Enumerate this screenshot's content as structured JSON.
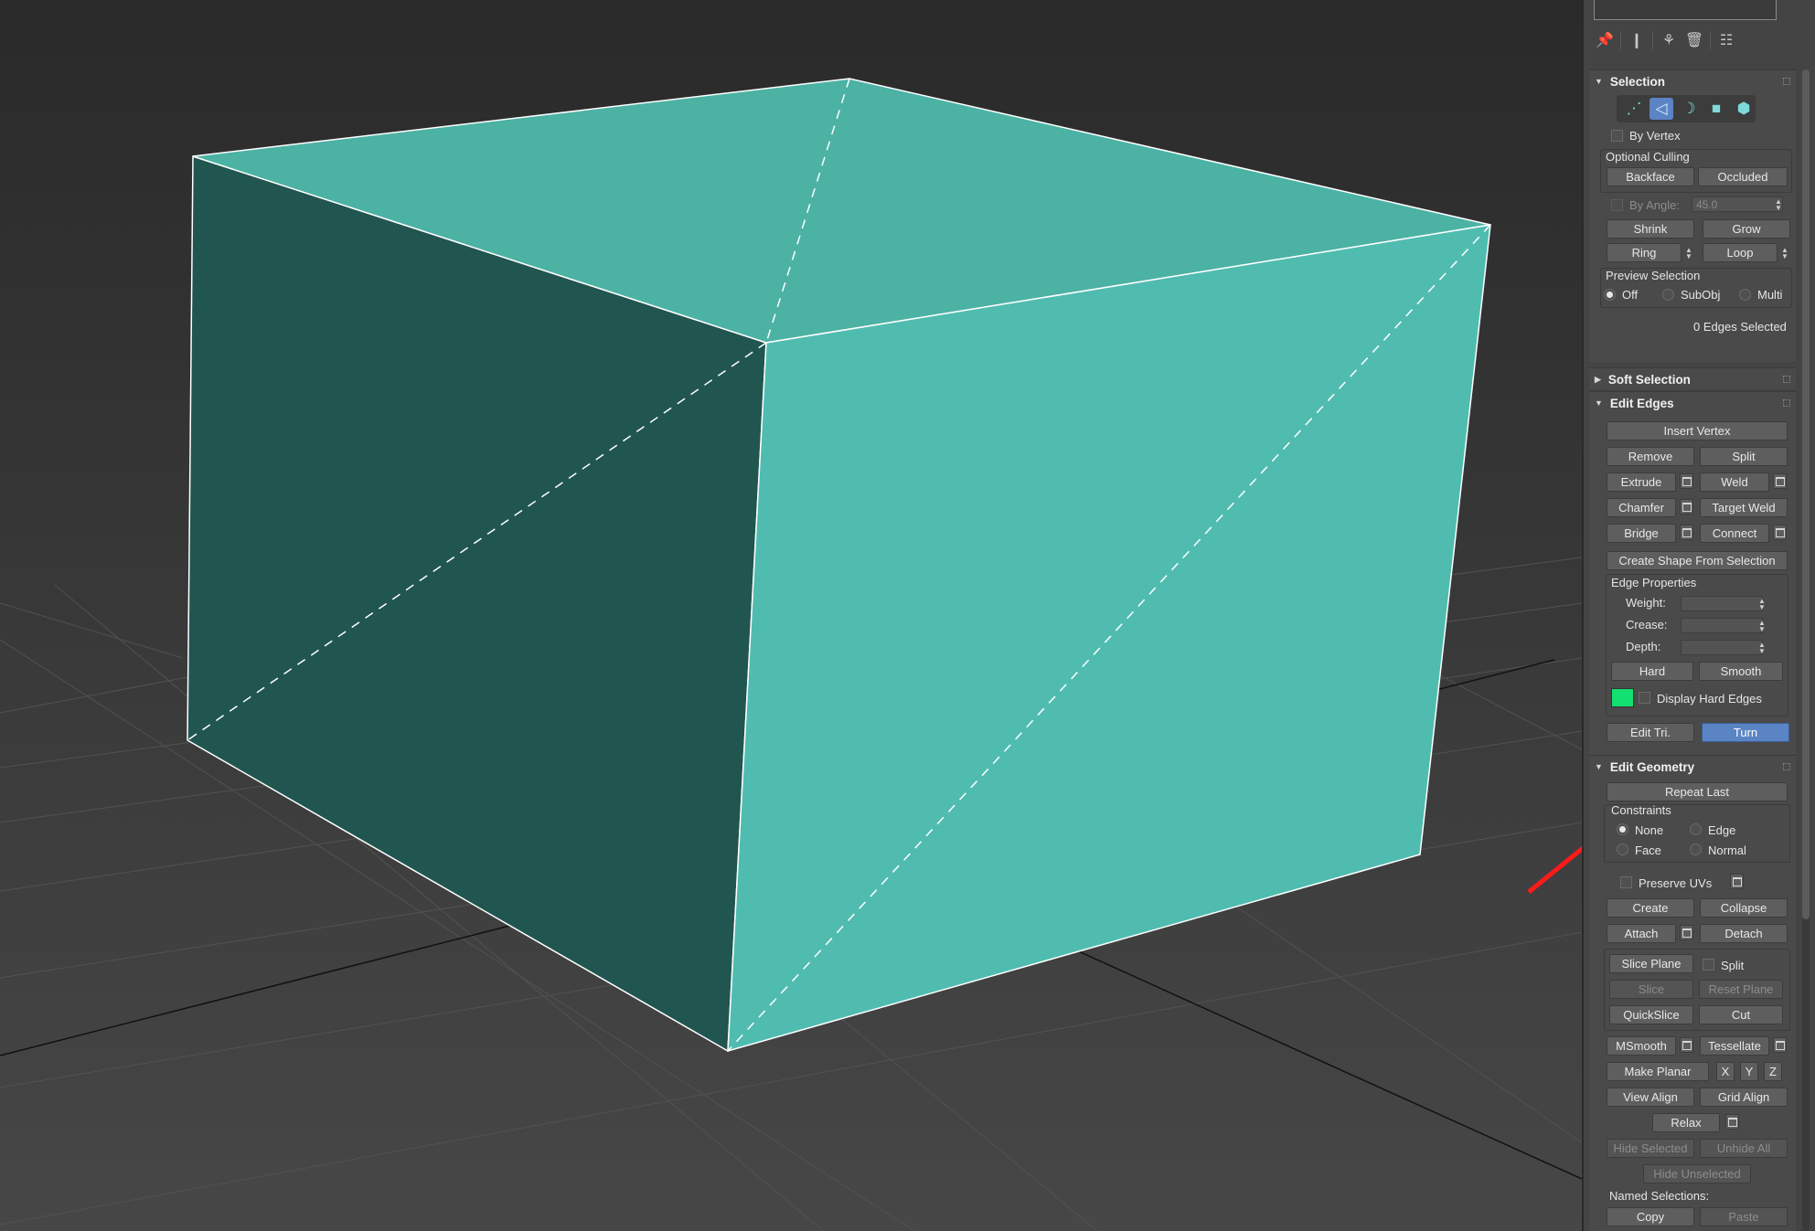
{
  "viewport": {
    "face_colors": {
      "top": "#4cb2a4",
      "front": "#50bcb0",
      "side": "#215550",
      "grid_line": "#4a4a4a",
      "axis": "#101010"
    },
    "edge_color": "#ffffff"
  },
  "panel": {
    "toolbar_icons": [
      "pin-icon",
      "modifier-stack-icon",
      "make-unique-icon",
      "delete-icon",
      "configure-icon"
    ],
    "selection": {
      "title": "Selection",
      "subobject_icons": [
        "vertex-icon",
        "edge-icon",
        "border-icon",
        "polygon-icon",
        "element-icon"
      ],
      "by_vertex": "By Vertex",
      "optional_culling": "Optional Culling",
      "backface": "Backface",
      "occluded": "Occluded",
      "by_angle": "By Angle:",
      "by_angle_value": "45.0",
      "shrink": "Shrink",
      "grow": "Grow",
      "ring": "Ring",
      "loop": "Loop",
      "preview_selection": "Preview Selection",
      "preview_off": "Off",
      "preview_subobj": "SubObj",
      "preview_multi": "Multi",
      "status": "0 Edges Selected"
    },
    "soft_selection": {
      "title": "Soft Selection"
    },
    "edit_edges": {
      "title": "Edit Edges",
      "insert_vertex": "Insert Vertex",
      "remove": "Remove",
      "split": "Split",
      "extrude": "Extrude",
      "weld": "Weld",
      "chamfer": "Chamfer",
      "target_weld": "Target Weld",
      "bridge": "Bridge",
      "connect": "Connect",
      "create_shape": "Create Shape From Selection",
      "edge_properties": "Edge Properties",
      "weight": "Weight:",
      "crease": "Crease:",
      "depth": "Depth:",
      "hard": "Hard",
      "smooth": "Smooth",
      "display_hard_edges": "Display Hard Edges",
      "hard_edge_color": "#12e070",
      "edit_tri": "Edit Tri.",
      "turn": "Turn"
    },
    "edit_geometry": {
      "title": "Edit Geometry",
      "repeat_last": "Repeat Last",
      "constraints": "Constraints",
      "none": "None",
      "edge": "Edge",
      "face": "Face",
      "normal": "Normal",
      "preserve_uvs": "Preserve UVs",
      "create": "Create",
      "collapse": "Collapse",
      "attach": "Attach",
      "detach": "Detach",
      "slice_plane": "Slice Plane",
      "split": "Split",
      "slice": "Slice",
      "reset_plane": "Reset Plane",
      "quickslice": "QuickSlice",
      "cut": "Cut",
      "msmooth": "MSmooth",
      "tessellate": "Tessellate",
      "make_planar": "Make Planar",
      "x": "X",
      "y": "Y",
      "z": "Z",
      "view_align": "View Align",
      "grid_align": "Grid Align",
      "relax": "Relax",
      "hide_selected": "Hide Selected",
      "unhide_all": "Unhide All",
      "hide_unselected": "Hide Unselected",
      "named_selections": "Named Selections:",
      "copy": "Copy",
      "paste": "Paste"
    }
  },
  "annotation": {
    "arrow_color": "#ff1a1a"
  }
}
